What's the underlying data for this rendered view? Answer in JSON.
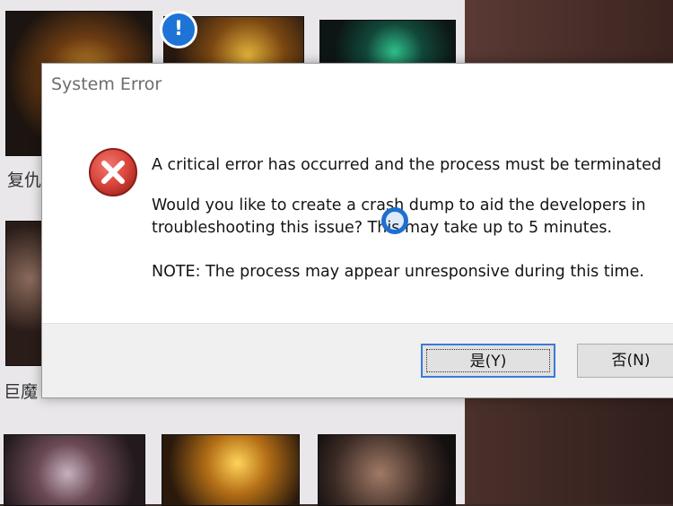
{
  "background_app": {
    "champion_labels": [
      "复仇",
      "巨魔"
    ],
    "alert_badge": "!"
  },
  "dialog": {
    "title": "System Error",
    "icon": "error-x-icon",
    "messages": [
      "A critical error has occurred and the process must be terminated",
      "Would you like to create a crash dump to aid the developers in",
      "troubleshooting this issue? This may take up to 5 minutes.",
      "NOTE: The process may appear unresponsive during this time."
    ],
    "buttons": {
      "yes_label": "是(Y)",
      "no_label": "否(N)"
    }
  },
  "colors": {
    "error_red": "#d9453c",
    "focus_blue": "#3b7bd6",
    "badge_blue": "#1e74d6"
  }
}
